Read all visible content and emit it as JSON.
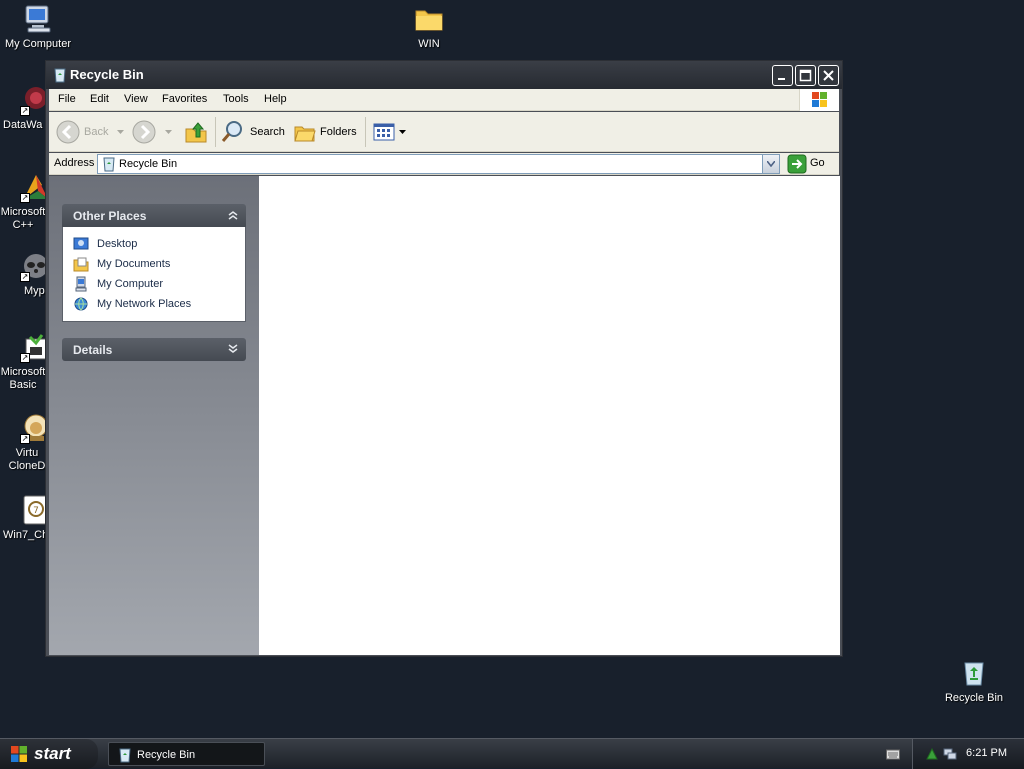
{
  "desktop": {
    "icons": [
      {
        "label": "My Computer"
      },
      {
        "label": "WIN"
      },
      {
        "label": "DataWa"
      },
      {
        "label": "Microsoft C++"
      },
      {
        "label": "Myp"
      },
      {
        "label": "Microsoft Basic"
      },
      {
        "label": "Virtu CloneD"
      },
      {
        "label": "Win7_Ch"
      },
      {
        "label": "Recycle Bin"
      }
    ]
  },
  "window": {
    "title": "Recycle Bin",
    "menu": [
      "File",
      "Edit",
      "View",
      "Favorites",
      "Tools",
      "Help"
    ],
    "toolbar": {
      "back": "Back",
      "search": "Search",
      "folders": "Folders"
    },
    "address": {
      "label": "Address",
      "value": "Recycle Bin",
      "go": "Go"
    },
    "taskpane": {
      "other_places": {
        "title": "Other Places",
        "links": [
          "Desktop",
          "My Documents",
          "My Computer",
          "My Network Places"
        ]
      },
      "details": {
        "title": "Details"
      }
    }
  },
  "taskbar": {
    "start": "start",
    "task_label": "Recycle Bin",
    "clock": "6:21 PM"
  },
  "colors": {
    "desktop_bg": "#18202c",
    "window_chrome": "#262a31",
    "pane_header": "#454a52"
  }
}
